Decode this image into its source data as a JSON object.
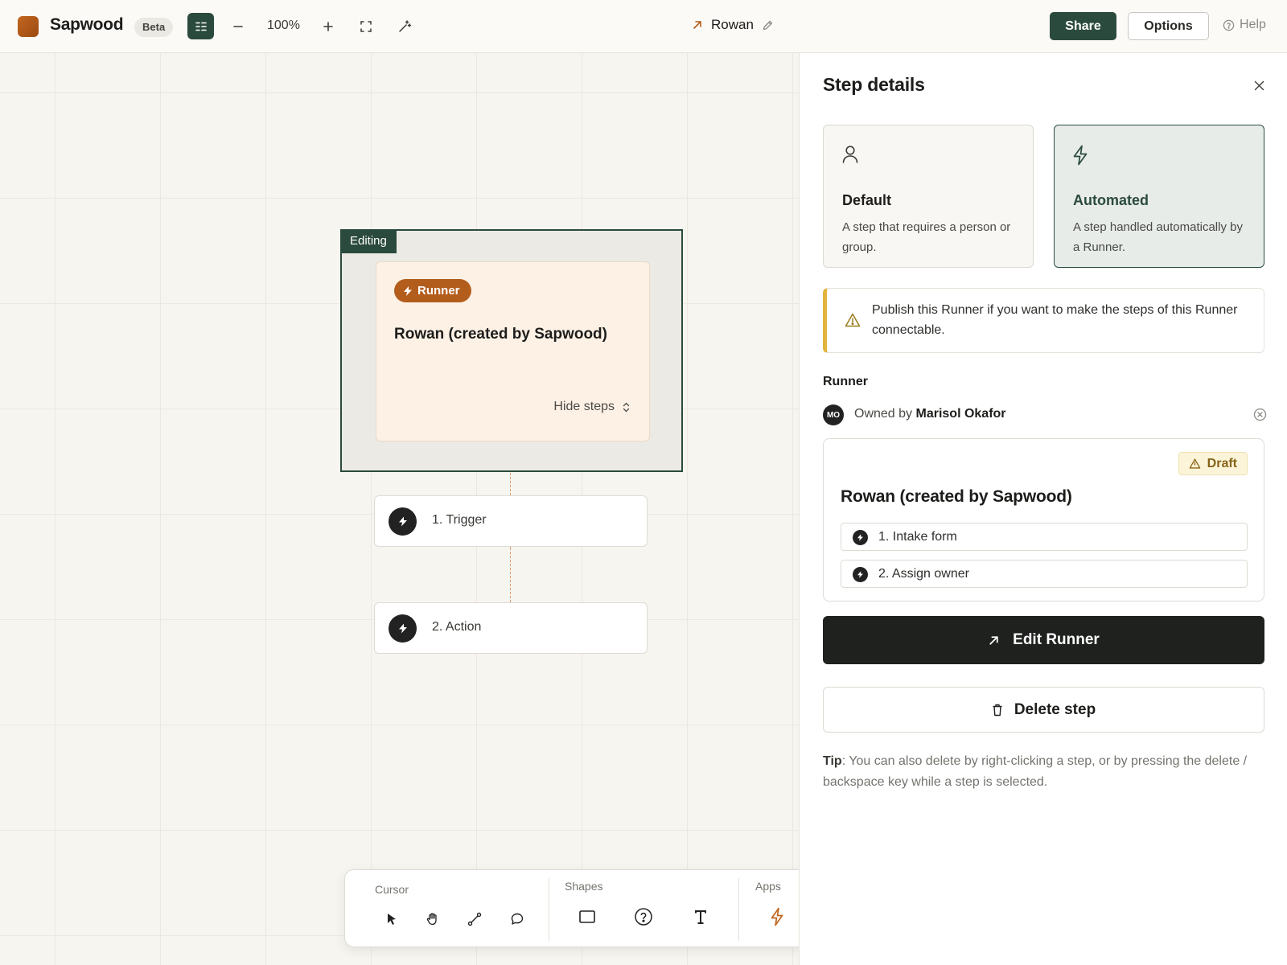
{
  "topbar": {
    "brand": "Sapwood",
    "badge": "Beta",
    "zoom": "100%",
    "doc_title": "Rowan",
    "share_label": "Share",
    "options_label": "Options",
    "help_label": "Help",
    "icons": [
      "menu-icon",
      "zoom-out-icon",
      "zoom-in-icon",
      "fit-screen-icon",
      "magic-wand-icon",
      "external-link-icon",
      "pencil-icon",
      "help-circle-icon"
    ]
  },
  "canvas": {
    "group_tag": "Editing",
    "runner_pill": "Runner",
    "runner_title": "Rowan (created by Sapwood)",
    "hide_steps": "Hide steps",
    "steps": [
      {
        "label": "1. Trigger"
      },
      {
        "label": "2. Action"
      }
    ]
  },
  "toolbar": {
    "sections": [
      {
        "label": "Cursor",
        "tools": [
          "pointer-icon",
          "hand-icon",
          "connector-icon",
          "comment-icon"
        ]
      },
      {
        "label": "Shapes",
        "tools": [
          "rectangle-icon",
          "question-icon",
          "text-icon"
        ]
      },
      {
        "label": "Apps",
        "tools": [
          "lightning-icon",
          "sliders-icon",
          "frame-icon"
        ]
      }
    ]
  },
  "panel": {
    "title": "Step details",
    "types": [
      {
        "name": "Default",
        "desc": "A step that requires a person or group.",
        "selected": false
      },
      {
        "name": "Automated",
        "desc": "A step handled automatically by a Runner.",
        "selected": true
      }
    ],
    "notice": "Publish this Runner if you want to make the steps of this Runner connectable.",
    "runner_label": "Runner",
    "owner_initials": "MO",
    "owner_prefix": "Owned by",
    "owner_name": "Marisol Okafor",
    "draft_label": "Draft",
    "runner_title": "Rowan (created by Sapwood)",
    "runner_steps": [
      {
        "label": "1. Intake form"
      },
      {
        "label": "2. Assign owner"
      }
    ],
    "edit_label": "Edit Runner",
    "delete_label": "Delete step",
    "tip_label": "Tip",
    "tip_text": ": You can also delete by right-clicking a step, or by pressing the delete / backspace key while a step is selected."
  },
  "colors": {
    "accent": "#2b4a3e",
    "brand_orange": "#b35d1d",
    "warning": "#e2b43c"
  }
}
